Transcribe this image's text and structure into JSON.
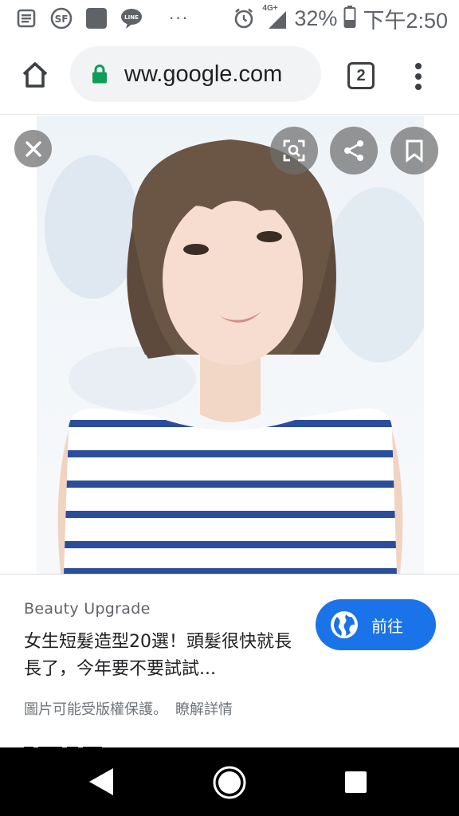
{
  "status_bar": {
    "network": "4G+",
    "battery": "32%",
    "time": "下午2:50",
    "more": "···",
    "notification_icons": [
      "news-icon",
      "sf-app-icon",
      "app-square-icon",
      "line-icon"
    ]
  },
  "browser": {
    "url": "ww.google.com",
    "tab_count": "2"
  },
  "result": {
    "source": "Beauty Upgrade",
    "title": "女生短髮造型20選！頭髮很快就長長了，今年要不要試試...",
    "copyright_notice": "圖片可能受版權保護。",
    "learn_more": "瞭解詳情",
    "visit_label": "前往"
  },
  "colors": {
    "accent": "#1a73e8",
    "lock_green": "#0f9d58",
    "stripe_blue": "#2b4e9c"
  }
}
